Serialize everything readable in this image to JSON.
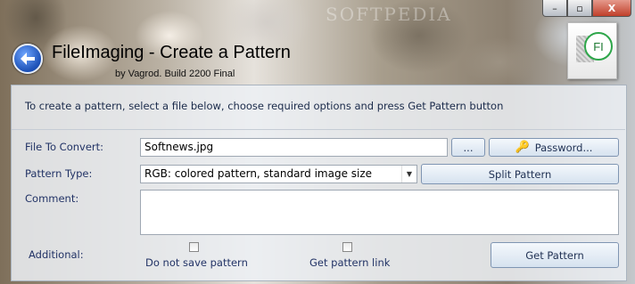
{
  "window": {
    "title": "FileImaging - Create a Pattern",
    "subtitle": "by Vagrod. Build 2200 Final",
    "watermark": "SOFTPEDIA",
    "controls": {
      "minimize": "–",
      "maximize": "▫",
      "close": "X"
    }
  },
  "app_icon": {
    "badge": "FI"
  },
  "intro_text": "To create a pattern, select a file below, choose required options and press Get Pattern button",
  "form": {
    "file_label": "File To Convert:",
    "file_value": "Softnews.jpg",
    "browse_label": "...",
    "password_label": "Password...",
    "pattern_type_label": "Pattern Type:",
    "pattern_type_value": "RGB: colored pattern, standard image size",
    "split_pattern_label": "Split Pattern",
    "comment_label": "Comment:",
    "comment_value": "",
    "additional_label": "Additional:",
    "do_not_save_label": "Do not save pattern",
    "do_not_save_checked": false,
    "get_link_label": "Get pattern link",
    "get_link_checked": false,
    "get_pattern_label": "Get Pattern"
  },
  "icons": [
    "back-arrow-icon",
    "key-icon",
    "combo-arrow-icon"
  ]
}
